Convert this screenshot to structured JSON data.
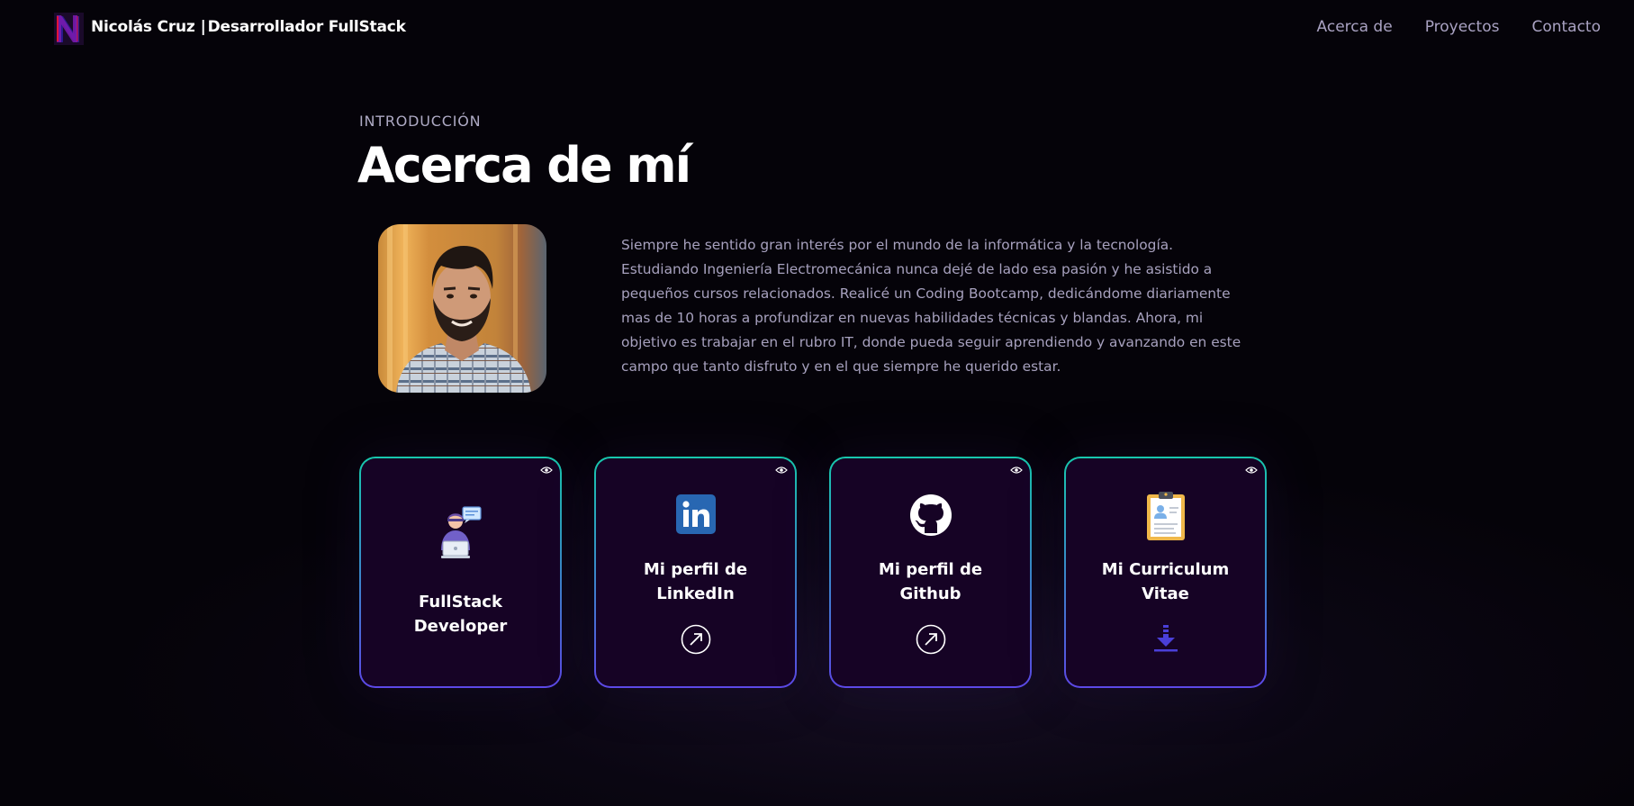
{
  "nav": {
    "logo_icon": "n-logo-icon",
    "brand_name": "Nicolás Cruz",
    "brand_separator": "|",
    "brand_role": "Desarrollador FullStack",
    "links": [
      "Acerca de",
      "Proyectos",
      "Contacto"
    ]
  },
  "about": {
    "eyebrow": "INTRODUCCIÓN",
    "title": "Acerca de mí",
    "bio": "Siempre he sentido gran interés por el mundo de la informática y la tecnología. Estudiando Ingeniería Electromecánica nunca dejé de lado esa pasión y he asistido a pequeños cursos relacionados. Realicé un Coding Bootcamp, dedicándome diariamente mas de 10 horas a profundizar en nuevas habilidades técnicas y blandas. Ahora, mi objetivo es trabajar en el rubro IT, donde pueda seguir aprendiendo y avanzando en este campo que tanto disfruto y en el que siempre he querido estar."
  },
  "cards": [
    {
      "line1": "FullStack",
      "line2": "Developer",
      "icon": "developer-illustration-icon"
    },
    {
      "line1": "Mi perfil de",
      "line2": "LinkedIn",
      "icon": "linkedin-icon",
      "action_icon": "external-link-icon"
    },
    {
      "line1": "Mi perfil de",
      "line2": "Github",
      "icon": "github-icon",
      "action_icon": "external-link-icon"
    },
    {
      "line1": "Mi Curriculum",
      "line2": "Vitae",
      "icon": "clipboard-cv-icon",
      "action_icon": "download-icon"
    }
  ],
  "colors": {
    "background": "#050309",
    "card_background": "#160325",
    "card_border_top": "#17c8ad",
    "card_border_bottom": "#5c48e6",
    "muted_text": "#a7a1be",
    "linkedin_blue": "#2867b2",
    "download_accent": "#4a3fd8"
  }
}
